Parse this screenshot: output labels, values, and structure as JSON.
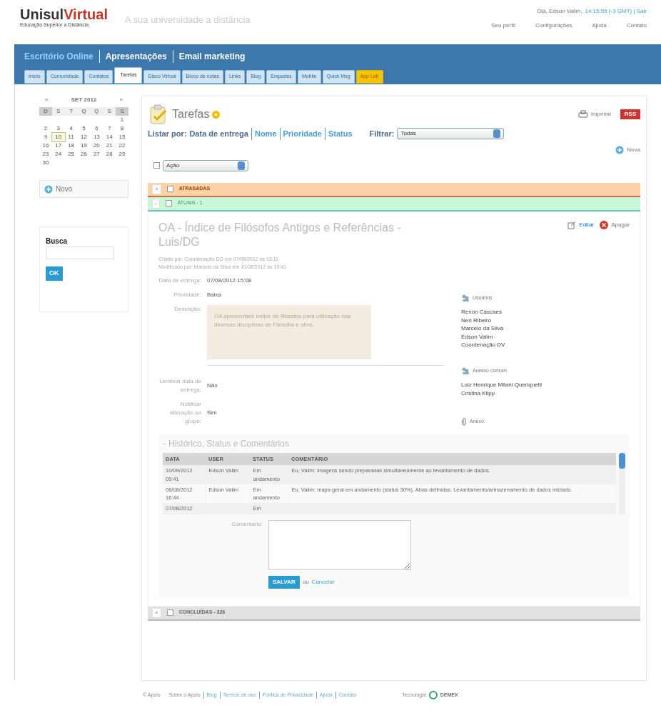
{
  "header": {
    "logo_main": "Unisul",
    "logo_accent": "Virtual",
    "logo_sub": "Educação Superior a Distância",
    "tagline": "A sua universidade a distância",
    "greeting": "Olá, Edson Valim,",
    "clock": "14:15:55 (-3 GMT) | Sair",
    "links": [
      "Seu perfil",
      "Configurações",
      "Ajuda",
      "Contato"
    ]
  },
  "nav": {
    "sections": [
      {
        "label": "Escritório Online",
        "selected": true
      },
      {
        "label": "Apresentações",
        "selected": false
      },
      {
        "label": "Email marketing",
        "selected": false
      }
    ],
    "tabs": [
      {
        "label": "Início",
        "selected": false,
        "kind": "normal"
      },
      {
        "label": "Comunidade",
        "selected": false,
        "kind": "normal"
      },
      {
        "label": "Contatos",
        "selected": false,
        "kind": "normal"
      },
      {
        "label": "Tarefas",
        "selected": true,
        "kind": "normal"
      },
      {
        "label": "Disco Virtual",
        "selected": false,
        "kind": "normal"
      },
      {
        "label": "Bloco de notas",
        "selected": false,
        "kind": "normal"
      },
      {
        "label": "Links",
        "selected": false,
        "kind": "normal"
      },
      {
        "label": "Blog",
        "selected": false,
        "kind": "normal"
      },
      {
        "label": "Enquetes",
        "selected": false,
        "kind": "normal"
      },
      {
        "label": "Mobile",
        "selected": false,
        "kind": "normal"
      },
      {
        "label": "Quick Msg",
        "selected": false,
        "kind": "normal"
      },
      {
        "label": "App Lab",
        "selected": false,
        "kind": "highlight"
      }
    ]
  },
  "calendar": {
    "prev": "«",
    "month": "SET 2012",
    "next": "»",
    "weekdays": [
      {
        "label": "D",
        "weekend": true
      },
      {
        "label": "S",
        "weekend": false
      },
      {
        "label": "T",
        "weekend": false
      },
      {
        "label": "Q",
        "weekend": false
      },
      {
        "label": "Q",
        "weekend": false
      },
      {
        "label": "S",
        "weekend": false
      },
      {
        "label": "S",
        "weekend": true
      }
    ],
    "weeks": [
      [
        {
          "label": "1",
          "today": false
        }
      ],
      [
        {
          "label": "2",
          "today": false
        },
        {
          "label": "3",
          "today": false
        },
        {
          "label": "4",
          "today": false
        },
        {
          "label": "5",
          "today": false
        },
        {
          "label": "6",
          "today": false
        },
        {
          "label": "7",
          "today": false
        },
        {
          "label": "8",
          "today": false
        }
      ],
      [
        {
          "label": "9",
          "today": false
        },
        {
          "label": "10",
          "today": true
        },
        {
          "label": "11",
          "today": false
        },
        {
          "label": "12",
          "today": false
        },
        {
          "label": "13",
          "today": false
        },
        {
          "label": "14",
          "today": false
        },
        {
          "label": "15",
          "today": false
        }
      ],
      [
        {
          "label": "16",
          "today": false
        },
        {
          "label": "17",
          "today": false
        },
        {
          "label": "18",
          "today": false
        },
        {
          "label": "19",
          "today": false
        },
        {
          "label": "20",
          "today": false
        },
        {
          "label": "21",
          "today": false
        },
        {
          "label": "22",
          "today": false
        }
      ],
      [
        {
          "label": "23",
          "today": false
        },
        {
          "label": "24",
          "today": false
        },
        {
          "label": "25",
          "today": false
        },
        {
          "label": "26",
          "today": false
        },
        {
          "label": "27",
          "today": false
        },
        {
          "label": "28",
          "today": false
        },
        {
          "label": "29",
          "today": false
        }
      ],
      [
        {
          "label": "30",
          "today": false
        }
      ]
    ]
  },
  "sidebar": {
    "new_button": "Novo",
    "search_label": "Busca",
    "search_button": "OK"
  },
  "tasks": {
    "title": "Tarefas",
    "list_by_label": "Listar por:",
    "sort_links": [
      "Data de entrega",
      "Nome",
      "Prioridade",
      "Status"
    ],
    "filter_label": "Filtrar:",
    "filter_value": "Todas",
    "print": "Imprimir",
    "rss": "RSS",
    "new_task": "Nova",
    "action_value": "Ação",
    "select_all_checked": false,
    "groups": [
      {
        "toggle": "+",
        "label": "ATRASADAS",
        "kind": "late",
        "expanded": false,
        "checked": false
      },
      {
        "toggle": "-",
        "label": "ATUAIS - 1",
        "kind": "current",
        "expanded": true,
        "checked": false
      },
      {
        "toggle": "+",
        "label": "CONCLUÍDAS - 326",
        "kind": "done",
        "expanded": false,
        "checked": false
      }
    ]
  },
  "task": {
    "title": "OA - Índice de Filósofos Antigos e Referências - Luis/DG",
    "created": "Criado por: Coordenação DG em 07/08/2012 às 13:11",
    "modified": "Modificado por: Marcelo da Silva em 10/08/2012 às 19:41",
    "edit": "Editar",
    "delete": "Apagar",
    "fields": [
      {
        "label": "Data de entrega:",
        "value": "07/08/2012 15:08",
        "kind": "text"
      },
      {
        "label": "Prioridade:",
        "value": "Baixa",
        "kind": "text"
      },
      {
        "label": "Descrição:",
        "value": "OA apresentará índice de filósofos para utilização nas diversas disciplinas de Filosofia e afins.",
        "kind": "note"
      },
      {
        "label": "Lembrar data de entrega:",
        "value": "Não",
        "kind": "text"
      },
      {
        "label": "Notificar alteração ao grupo:",
        "value": "Sim",
        "kind": "text"
      }
    ],
    "users_heading": "Usuários",
    "users": [
      "Renon Cascaes",
      "Neri Ribeiro",
      "Marcelo da Silva",
      "Edson Valim",
      "Coordenação DV"
    ],
    "access_heading": "Acesso comum",
    "access": [
      "Luiz Henrique Milani Queriquelli",
      "Cristina Klipp"
    ],
    "attachment": "Anexo",
    "history": {
      "toggle": "-",
      "title": "Histórico, Status e Comentários",
      "columns": [
        "DATA",
        "USER",
        "STATUS",
        "COMENTÁRIO"
      ],
      "rows": [
        {
          "date": "10/09/2012 09:41",
          "user": "Edson Valim",
          "status": "Em andamento",
          "comment": "Eu, Valim: imagens sendo preparadas simultaneamente ao levantamento de dados."
        },
        {
          "date": "08/08/2012 16:44",
          "user": "Edson Valim",
          "status": "Em andamento",
          "comment": "Eu, Valim: mapa geral em andamento (status 30%). Abas definidas. Levantamento/armazenamento de dados iniciado."
        },
        {
          "date": "07/08/2012",
          "status": "Em"
        }
      ]
    },
    "comment_label": "Comentário:",
    "save": "SALVAR",
    "or": "ou",
    "cancel": "Cancelar"
  },
  "footer": {
    "brand": "© Apoio",
    "links": [
      "Sobre o Apoio",
      "Blog",
      "Termos de uso",
      "Política de Privacidade",
      "Ajuda",
      "Contato"
    ],
    "tech_label": "Tecnologia",
    "tech_name": "DEMEX"
  }
}
